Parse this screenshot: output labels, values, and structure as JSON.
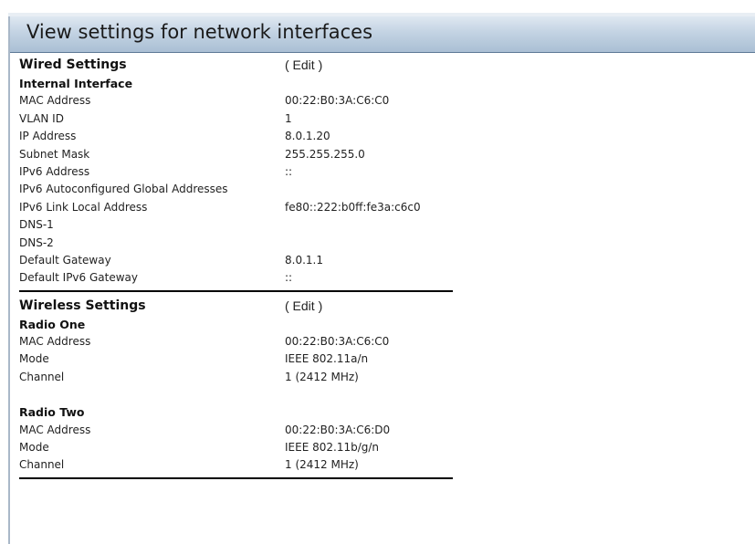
{
  "page": {
    "title": "View settings for network interfaces"
  },
  "wired": {
    "heading": "Wired Settings",
    "edit_label": "( Edit )",
    "interface_heading": "Internal Interface",
    "rows": [
      {
        "label": "MAC Address",
        "value": "00:22:B0:3A:C6:C0"
      },
      {
        "label": "VLAN ID",
        "value": "1"
      },
      {
        "label": "IP Address",
        "value": "8.0.1.20"
      },
      {
        "label": "Subnet Mask",
        "value": "255.255.255.0"
      },
      {
        "label": "IPv6 Address",
        "value": "::"
      },
      {
        "label": "IPv6 Autoconfigured Global Addresses",
        "value": ""
      },
      {
        "label": "IPv6 Link Local Address",
        "value": "fe80::222:b0ff:fe3a:c6c0"
      },
      {
        "label": "DNS-1",
        "value": ""
      },
      {
        "label": "DNS-2",
        "value": ""
      },
      {
        "label": "Default Gateway",
        "value": "8.0.1.1"
      },
      {
        "label": "Default IPv6 Gateway",
        "value": "::"
      }
    ]
  },
  "wireless": {
    "heading": "Wireless Settings",
    "edit_label": "( Edit )",
    "radio_one": {
      "heading": "Radio One",
      "rows": [
        {
          "label": "MAC Address",
          "value": "00:22:B0:3A:C6:C0"
        },
        {
          "label": "Mode",
          "value": "IEEE 802.11a/n"
        },
        {
          "label": "Channel",
          "value": "1 (2412 MHz)"
        }
      ]
    },
    "radio_two": {
      "heading": "Radio Two",
      "rows": [
        {
          "label": "MAC Address",
          "value": "00:22:B0:3A:C6:D0"
        },
        {
          "label": "Mode",
          "value": "IEEE 802.11b/g/n"
        },
        {
          "label": "Channel",
          "value": "1 (2412 MHz)"
        }
      ]
    }
  }
}
